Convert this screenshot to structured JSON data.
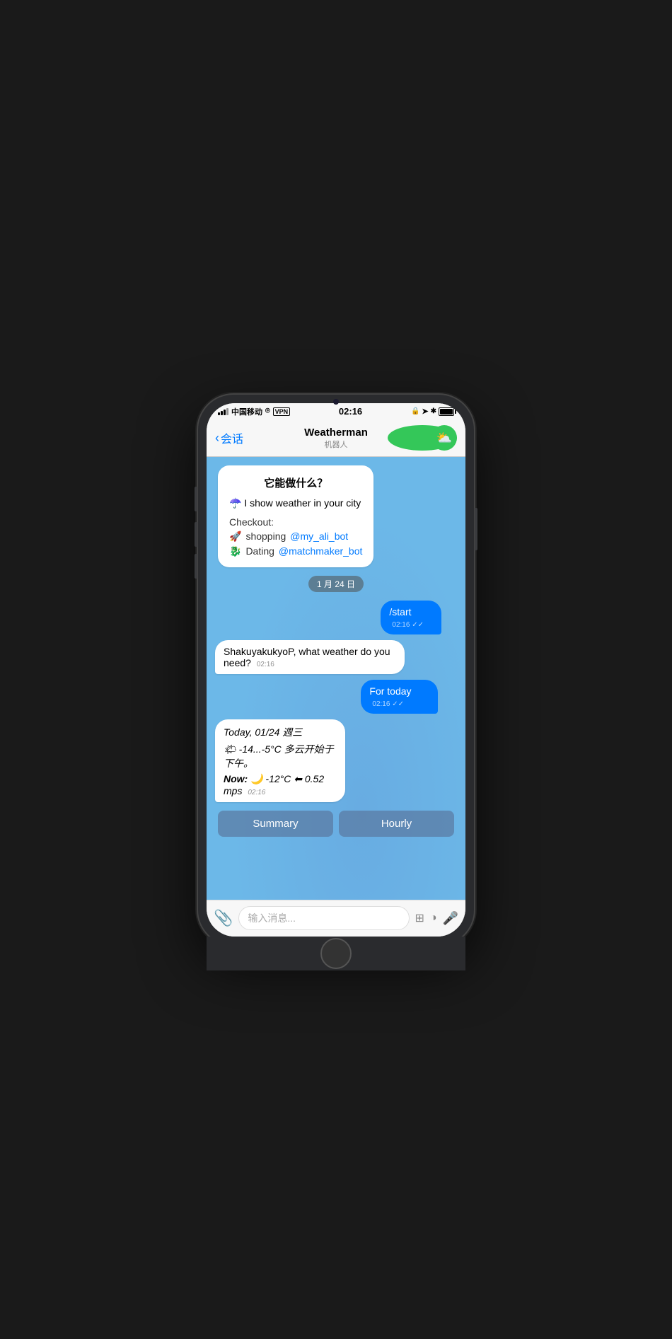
{
  "statusBar": {
    "carrier": "中国移动",
    "wifi": "wifi",
    "vpn": "VPN",
    "time": "02:16",
    "lock": "🔒",
    "location": "↗",
    "bluetooth": "✱"
  },
  "navBar": {
    "backLabel": "会话",
    "botName": "Weatherman",
    "botSubtitle": "机器人",
    "avatarEmoji": "⛅"
  },
  "chat": {
    "welcomeTitle": "它能做什么？",
    "welcomeDesc": "☂️ I show weather in your city",
    "checkoutLabel": "Checkout:",
    "shoppingLine": "🚀 shopping ",
    "shoppingLink": "@my_ali_bot",
    "datingLine": "🐉 Dating ",
    "datingLink": "@matchmaker_bot",
    "dateDivider": "1 月 24 日",
    "userMsg1": "/start",
    "userMsg1Time": "02:16",
    "botMsg1": "ShakuyakukyoP, what weather do you need?",
    "botMsg1Time": "02:16",
    "userMsg2": "For today",
    "userMsg2Time": "02:16",
    "weatherMsg": {
      "line1": "Today, 01/24 週三",
      "line2": "🌤 -14...-5°C 多云开始于下午。",
      "line3": "Now: 🌙 -12°C ⬅ 0.52 mps",
      "time": "02:16"
    },
    "btn1": "Summary",
    "btn2": "Hourly"
  },
  "inputBar": {
    "placeholder": "输入消息..."
  }
}
